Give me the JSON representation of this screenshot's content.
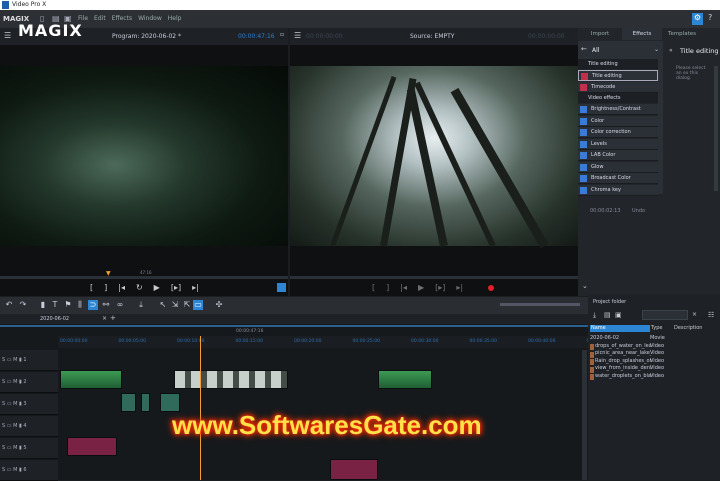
{
  "window": {
    "title": "Video Pro X"
  },
  "menubar": {
    "logo": "MAGIX",
    "items": [
      "File",
      "Edit",
      "Effects",
      "Window",
      "Help"
    ]
  },
  "brand": {
    "logo_big": "MAGIX"
  },
  "program_monitor": {
    "title": "Program: 2020-06-02 *",
    "timecode_left": "00:00:47:16",
    "timecode_right": "00:00:47:16",
    "scrub_label": "47:16"
  },
  "source_monitor": {
    "title": "Source: EMPTY",
    "timecode_left": "00:00:00:00",
    "timecode_right": "00:00:00:00"
  },
  "right_panel": {
    "tabs": [
      "Import",
      "Effects",
      "Templates"
    ],
    "active_tab": "Effects",
    "filter": "All",
    "detail_title": "Title editing",
    "detail_text": "Please select an ex this dialog.",
    "categories": [
      {
        "label": "Title editing",
        "items": [
          {
            "label": "Title editing",
            "selected": true
          },
          {
            "label": "Timecode"
          }
        ]
      },
      {
        "label": "Video effects",
        "items": [
          {
            "label": "Brightness/Contrast"
          },
          {
            "label": "Color"
          },
          {
            "label": "Color correction"
          },
          {
            "label": "Levels"
          },
          {
            "label": "LAB Color"
          },
          {
            "label": "Glow"
          },
          {
            "label": "Broadcast Color"
          },
          {
            "label": "Chroma key"
          }
        ]
      }
    ],
    "footer_timecode": "00:00:02:13",
    "footer_label": "Undo"
  },
  "timeline": {
    "tab": "2020-06-02",
    "playhead_timecode": "00:00:47:16",
    "ruler": [
      "00:00:00:00",
      "00:00:05:00",
      "00:00:10:00",
      "00:00:15:00",
      "00:00:20:00",
      "00:00:25:00",
      "00:00:30:00",
      "00:00:35:00",
      "00:00:40:00",
      "00:00:45:00",
      "00:00:50:00"
    ],
    "tracks": [
      "1",
      "2",
      "3",
      "4",
      "5",
      "6"
    ]
  },
  "project_folder": {
    "title": "Project folder",
    "columns": [
      "Name",
      "Type",
      "Description"
    ],
    "rows": [
      {
        "name": "2020-06-02",
        "type": "Movie"
      },
      {
        "name": "drops_of_water_on_lea...",
        "type": "Video"
      },
      {
        "name": "picnic_area_near_lake_s...",
        "type": "Video"
      },
      {
        "name": "Rain_drop_splashes_on...",
        "type": "Video"
      },
      {
        "name": "view_from_inside_dense...",
        "type": "Video"
      },
      {
        "name": "water_droplets_on_blad...",
        "type": "Video"
      }
    ]
  },
  "watermark": "www.SoftwaresGate.com",
  "colors": {
    "accent": "#2d86d4",
    "timecode": "#2e7fd0",
    "playhead": "#f0a030",
    "record": "#e0202a"
  }
}
